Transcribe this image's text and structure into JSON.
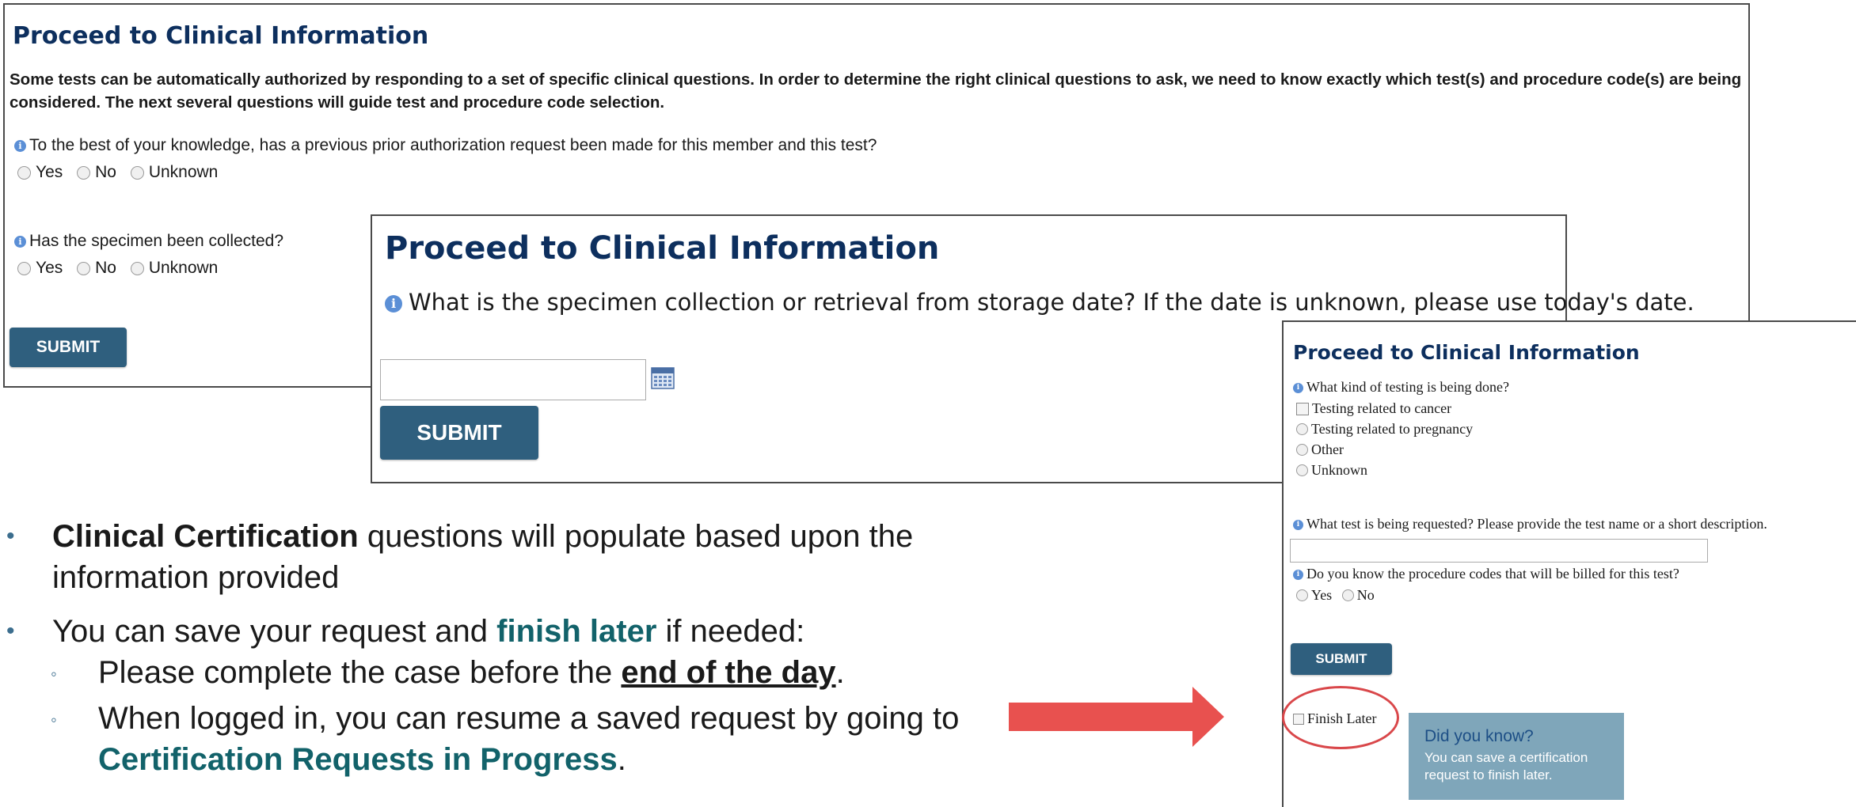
{
  "panel1": {
    "title": "Proceed to Clinical Information",
    "intro": "Some tests can be automatically authorized by responding to a set of specific clinical questions. In order to determine the right clinical questions to ask, we need to know exactly which test(s) and procedure code(s) are being considered. The next several questions will guide test and procedure code selection.",
    "q1": "To the best of your knowledge, has a previous prior authorization request been made for this member and this test?",
    "q2": "Has the specimen been collected?",
    "options": [
      "Yes",
      "No",
      "Unknown"
    ],
    "submit": "SUBMIT"
  },
  "panel2": {
    "title": "Proceed to Clinical Information",
    "question": "What is the specimen collection or retrieval from storage date? If the date is unknown, please use today's date.",
    "date_value": "",
    "submit": "SUBMIT"
  },
  "panel3": {
    "title": "Proceed to Clinical Information",
    "q_kind": "What kind of testing is being done?",
    "kind_options": [
      "Testing related to cancer",
      "Testing related to pregnancy",
      "Other",
      "Unknown"
    ],
    "q_test": "What test is being requested? Please provide the test name or a short description.",
    "test_value": "",
    "q_codes": "Do you know the procedure codes that will be billed for this test?",
    "code_options": [
      "Yes",
      "No"
    ],
    "submit": "SUBMIT",
    "finish_later": "Finish Later",
    "did_you_know_title": "Did you know?",
    "did_you_know_body": "You can save a certification request to finish later."
  },
  "bullets": {
    "b1_bold": "Clinical Certification",
    "b1_rest": " questions will populate based upon the information provided",
    "b2_pre": "You can save your request and ",
    "b2_teal": "finish later",
    "b2_post": " if needed:",
    "b3_pre": "Please complete the case before the ",
    "b3_under": "end of the day",
    "b3_post": ".",
    "b4_pre": "When logged in, you can resume a saved request by going to ",
    "b4_teal": "Certification Requests in Progress",
    "b4_post": ".",
    "bullet_char": "•",
    "sub_bullet_char": "◦"
  },
  "colors": {
    "title": "#0d2f5e",
    "button": "#2f5f7e",
    "teal_text": "#12626a",
    "arrow": "#e8514f",
    "highlight_ellipse": "#d9474a",
    "did_you_know_bg": "#7fa6ba"
  }
}
